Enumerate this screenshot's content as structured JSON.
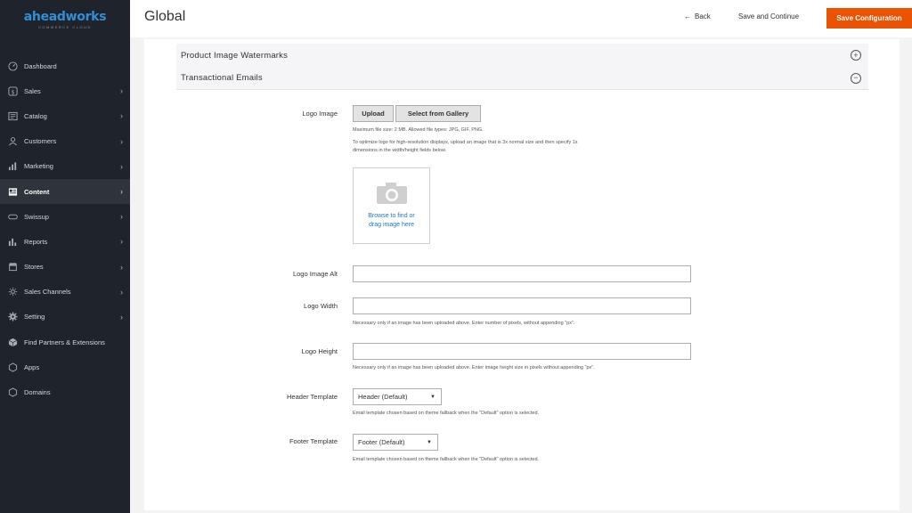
{
  "sidebar": {
    "logo_text": "aheadworks",
    "logo_subtext": "COMMERCE CLOUD",
    "items": [
      {
        "label": "Dashboard",
        "icon": "dashboard-icon"
      },
      {
        "label": "Sales",
        "icon": "dollar-icon"
      },
      {
        "label": "Catalog",
        "icon": "catalog-icon"
      },
      {
        "label": "Customers",
        "icon": "customers-icon"
      },
      {
        "label": "Marketing",
        "icon": "marketing-icon"
      },
      {
        "label": "Content",
        "icon": "content-icon"
      },
      {
        "label": "Swissup",
        "icon": "swissup-icon"
      },
      {
        "label": "Reports",
        "icon": "reports-icon"
      },
      {
        "label": "Stores",
        "icon": "stores-icon"
      },
      {
        "label": "Sales Channels",
        "icon": "sales-channels-icon"
      },
      {
        "label": "Setting",
        "icon": "gear-icon"
      },
      {
        "label": "Find Partners & Extensions",
        "icon": "extensions-icon"
      },
      {
        "label": "Apps",
        "icon": "hexagon-icon"
      },
      {
        "label": "Domains",
        "icon": "hexagon-icon"
      }
    ],
    "active": "Content"
  },
  "header": {
    "title": "Global",
    "back_label": "Back",
    "save_continue_label": "Save and Continue",
    "save_config_label": "Save Configuration"
  },
  "sections": {
    "watermarks_title": "Product Image Watermarks",
    "transactional_title": "Transactional Emails"
  },
  "form": {
    "logo_image_label": "Logo Image",
    "upload_label": "Upload",
    "gallery_label": "Select from Gallery",
    "max_size_note": "Maximum file size: 2 MB. Allowed file types: JPG, GIF, PNG.",
    "optimize_note_1": "To optimize logo for high-resolution displays, upload an image that is 3x normal size and then specify 1x",
    "optimize_note_2": "dimensions in the width/height fields below.",
    "dropzone_line1": "Browse to find or",
    "dropzone_line2": "drag image here",
    "logo_alt_label": "Logo Image Alt",
    "logo_alt_value": "",
    "logo_width_label": "Logo Width",
    "logo_width_value": "",
    "logo_width_note": "Necessary only if an image has been uploaded above. Enter number of pixels, without appending \"px\".",
    "logo_height_label": "Logo Height",
    "logo_height_value": "",
    "logo_height_note": "Necessary only if an image has been uploaded above. Enter image height size in pixels without appending \"px\".",
    "header_template_label": "Header Template",
    "header_template_value": "Header (Default)",
    "header_template_note": "Email template chosen based on theme fallback when the \"Default\" option is selected.",
    "footer_template_label": "Footer Template",
    "footer_template_value": "Footer (Default)",
    "footer_template_note": "Email template chosen based on theme fallback when the \"Default\" option is selected."
  },
  "colors": {
    "sidebar_bg": "#1f232b",
    "accent": "#eb5202",
    "link": "#1979c3"
  }
}
